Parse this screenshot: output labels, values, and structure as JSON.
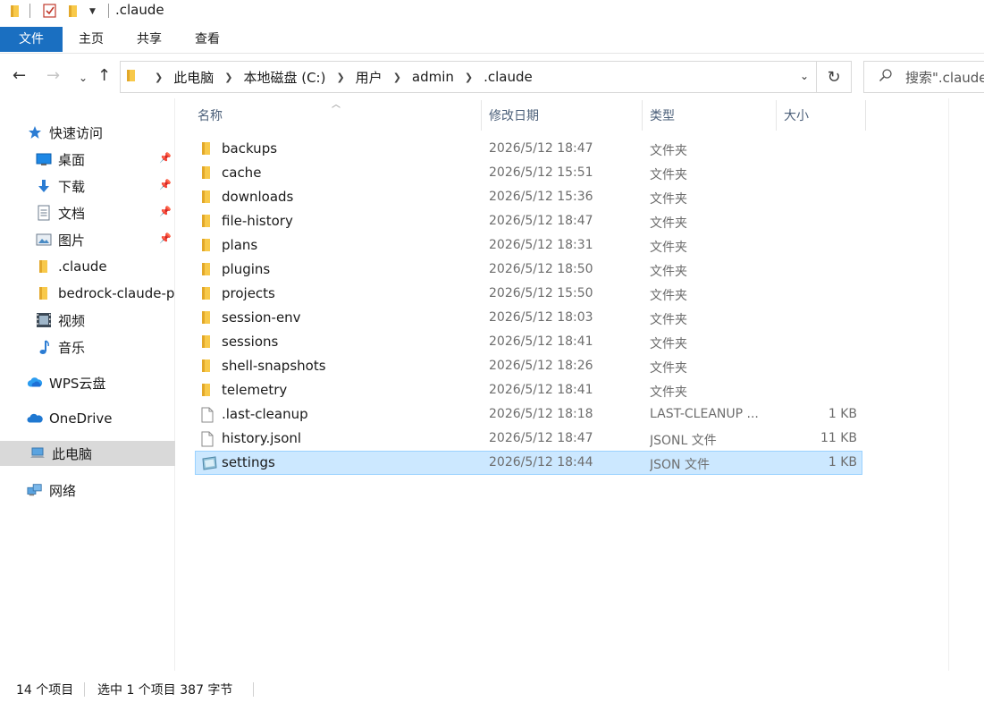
{
  "window": {
    "title": ".claude"
  },
  "ribbon": {
    "tabs": [
      {
        "label": "文件"
      },
      {
        "label": "主页"
      },
      {
        "label": "共享"
      },
      {
        "label": "查看"
      }
    ]
  },
  "address": {
    "crumbs": [
      "此电脑",
      "本地磁盘 (C:)",
      "用户",
      "admin",
      ".claude"
    ]
  },
  "search": {
    "placeholder": "搜索\".claude\""
  },
  "sidebar": {
    "items": [
      {
        "label": "快速访问",
        "icon": "star-icon"
      },
      {
        "label": "桌面",
        "icon": "desktop-icon",
        "pinned": true
      },
      {
        "label": "下载",
        "icon": "download-icon",
        "pinned": true
      },
      {
        "label": "文档",
        "icon": "document-icon",
        "pinned": true
      },
      {
        "label": "图片",
        "icon": "pictures-icon",
        "pinned": true
      },
      {
        "label": ".claude",
        "icon": "folder-icon"
      },
      {
        "label": "bedrock-claude-p",
        "icon": "folder-icon"
      },
      {
        "label": "视频",
        "icon": "video-icon"
      },
      {
        "label": "音乐",
        "icon": "music-icon"
      },
      {
        "label": "WPS云盘",
        "icon": "cloud-icon"
      },
      {
        "label": "OneDrive",
        "icon": "onedrive-icon"
      },
      {
        "label": "此电脑",
        "icon": "computer-icon",
        "selected": true
      },
      {
        "label": "网络",
        "icon": "network-icon"
      }
    ]
  },
  "columns": {
    "name": "名称",
    "date": "修改日期",
    "type": "类型",
    "size": "大小"
  },
  "files": [
    {
      "name": "backups",
      "date": "2026/5/12 18:47",
      "type": "文件夹",
      "size": "",
      "kind": "folder"
    },
    {
      "name": "cache",
      "date": "2026/5/12 15:51",
      "type": "文件夹",
      "size": "",
      "kind": "folder"
    },
    {
      "name": "downloads",
      "date": "2026/5/12 15:36",
      "type": "文件夹",
      "size": "",
      "kind": "folder"
    },
    {
      "name": "file-history",
      "date": "2026/5/12 18:47",
      "type": "文件夹",
      "size": "",
      "kind": "folder"
    },
    {
      "name": "plans",
      "date": "2026/5/12 18:31",
      "type": "文件夹",
      "size": "",
      "kind": "folder"
    },
    {
      "name": "plugins",
      "date": "2026/5/12 18:50",
      "type": "文件夹",
      "size": "",
      "kind": "folder"
    },
    {
      "name": "projects",
      "date": "2026/5/12 15:50",
      "type": "文件夹",
      "size": "",
      "kind": "folder"
    },
    {
      "name": "session-env",
      "date": "2026/5/12 18:03",
      "type": "文件夹",
      "size": "",
      "kind": "folder"
    },
    {
      "name": "sessions",
      "date": "2026/5/12 18:41",
      "type": "文件夹",
      "size": "",
      "kind": "folder"
    },
    {
      "name": "shell-snapshots",
      "date": "2026/5/12 18:26",
      "type": "文件夹",
      "size": "",
      "kind": "folder"
    },
    {
      "name": "telemetry",
      "date": "2026/5/12 18:41",
      "type": "文件夹",
      "size": "",
      "kind": "folder"
    },
    {
      "name": ".last-cleanup",
      "date": "2026/5/12 18:18",
      "type": "LAST-CLEANUP ...",
      "size": "1 KB",
      "kind": "file"
    },
    {
      "name": "history.jsonl",
      "date": "2026/5/12 18:47",
      "type": "JSONL 文件",
      "size": "11 KB",
      "kind": "file"
    },
    {
      "name": "settings",
      "date": "2026/5/12 18:44",
      "type": "JSON 文件",
      "size": "1 KB",
      "kind": "json",
      "selected": true
    }
  ],
  "status": {
    "count": "14 个项目",
    "selection": "选中 1 个项目  387 字节"
  },
  "colors": {
    "accent": "#1a6fc1",
    "selection_bg": "#cce8ff",
    "selection_border": "#99d1ff",
    "folder": "#f8c94a"
  }
}
